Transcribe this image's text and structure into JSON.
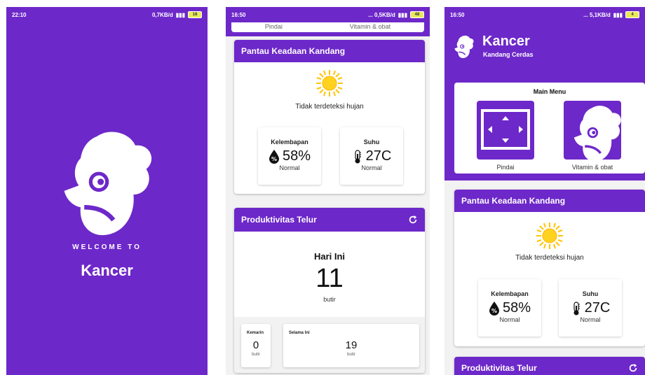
{
  "theme": {
    "primary": "#6d28c9",
    "background": "#f2f2f2",
    "sun": "#ffc400"
  },
  "screen1": {
    "status": {
      "time": "22:10",
      "net": "0,7KB/d",
      "battery": "18"
    },
    "welcome": "WELCOME TO",
    "brand": "Kancer"
  },
  "screen2": {
    "status": {
      "time": "16:50",
      "net": "... 0,5KB/d",
      "battery": "48"
    },
    "tabs": [
      "Pindai",
      "Vitamin & obat"
    ],
    "monitor": {
      "title": "Pantau Keadaan Kandang",
      "rain_text": "Tidak terdeteksi hujan",
      "humidity": {
        "label": "Kelembapan",
        "value": "58%",
        "status": "Normal",
        "icon": "humidity-drop-icon"
      },
      "temperature": {
        "label": "Suhu",
        "value": "27C",
        "status": "Normal",
        "icon": "thermometer-icon"
      }
    },
    "eggs": {
      "title": "Produktivitas Telur",
      "today_label": "Hari Ini",
      "today_value": "11",
      "unit": "butir",
      "yesterday_label": "Kemarin",
      "yesterday_value": "0",
      "total_label": "Selama Ini",
      "total_value": "19"
    }
  },
  "screen3": {
    "status": {
      "time": "16:50",
      "net": "... 5,1KB/d",
      "battery": "4"
    },
    "app_title": "Kancer",
    "app_subtitle": "Kandang Cerdas",
    "main_menu": {
      "title": "Main Menu",
      "items": [
        {
          "label": "Pindai",
          "icon": "scan-icon"
        },
        {
          "label": "Vitamin & obat",
          "icon": "chicken-icon"
        }
      ]
    },
    "monitor": {
      "title": "Pantau Keadaan Kandang",
      "rain_text": "Tidak terdeteksi hujan",
      "humidity": {
        "label": "Kelembapan",
        "value": "58%",
        "status": "Normal"
      },
      "temperature": {
        "label": "Suhu",
        "value": "27C",
        "status": "Normal"
      }
    },
    "eggs": {
      "title": "Produktivitas Telur"
    }
  }
}
